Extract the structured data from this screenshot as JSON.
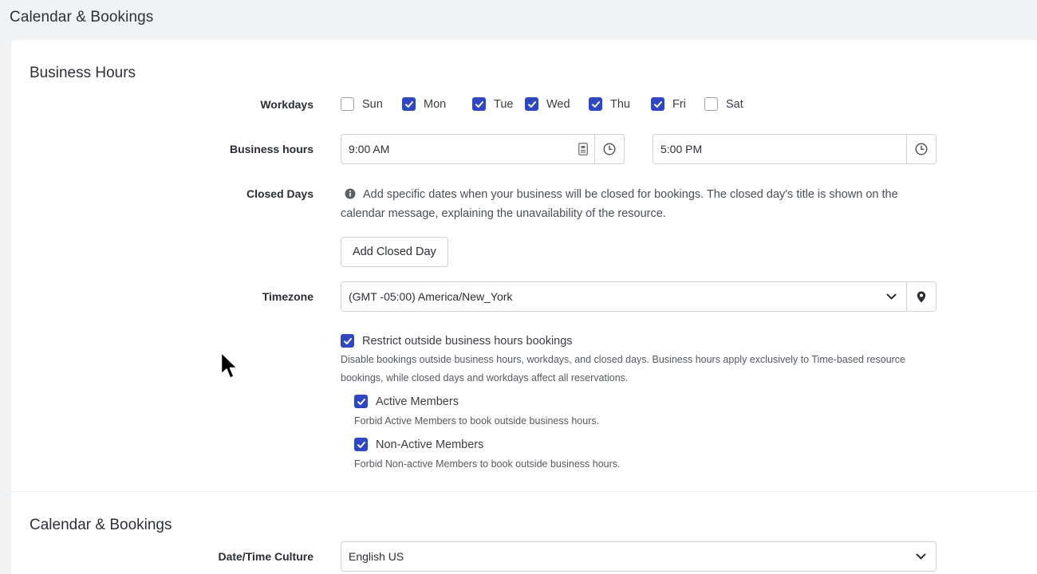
{
  "page": {
    "title": "Calendar & Bookings"
  },
  "business_hours": {
    "section_title": "Business Hours",
    "workdays_label": "Workdays",
    "days": [
      {
        "label": "Sun",
        "checked": false
      },
      {
        "label": "Mon",
        "checked": true
      },
      {
        "label": "Tue",
        "checked": true
      },
      {
        "label": "Wed",
        "checked": true
      },
      {
        "label": "Thu",
        "checked": true
      },
      {
        "label": "Fri",
        "checked": true
      },
      {
        "label": "Sat",
        "checked": false
      }
    ],
    "hours_label": "Business hours",
    "start_time": "9:00 AM",
    "end_time": "5:00 PM",
    "closed_days_label": "Closed Days",
    "closed_days_help": "Add specific dates when your business will be closed for bookings. The closed day's title is shown on the calendar message, explaining the unavailability of the resource.",
    "add_closed_day_button": "Add Closed Day",
    "timezone_label": "Timezone",
    "timezone_value": "(GMT -05:00) America/New_York",
    "restrict": {
      "label": "Restrict outside business hours bookings",
      "checked": true,
      "description": "Disable bookings outside business hours, workdays, and closed days. Business hours apply exclusively to Time-based resource bookings, while closed days and workdays affect all reservations.",
      "active_members": {
        "label": "Active Members",
        "checked": true,
        "description": "Forbid Active Members to book outside business hours."
      },
      "non_active_members": {
        "label": "Non-Active Members",
        "checked": true,
        "description": "Forbid Non-active Members to book outside business hours."
      }
    }
  },
  "calendar_bookings": {
    "section_title": "Calendar & Bookings",
    "culture_label": "Date/Time Culture",
    "culture_value": "English US"
  },
  "colors": {
    "accent": "#3047c4",
    "border": "#cfd3d7",
    "background": "#f1f2f4"
  },
  "icons": {
    "time_picker": "clock-icon",
    "calendar_addon": "contact-card-icon",
    "timezone": "map-pin-icon",
    "dropdown": "chevron-down-icon",
    "info": "info-icon",
    "cursor": "mouse-pointer-icon"
  }
}
